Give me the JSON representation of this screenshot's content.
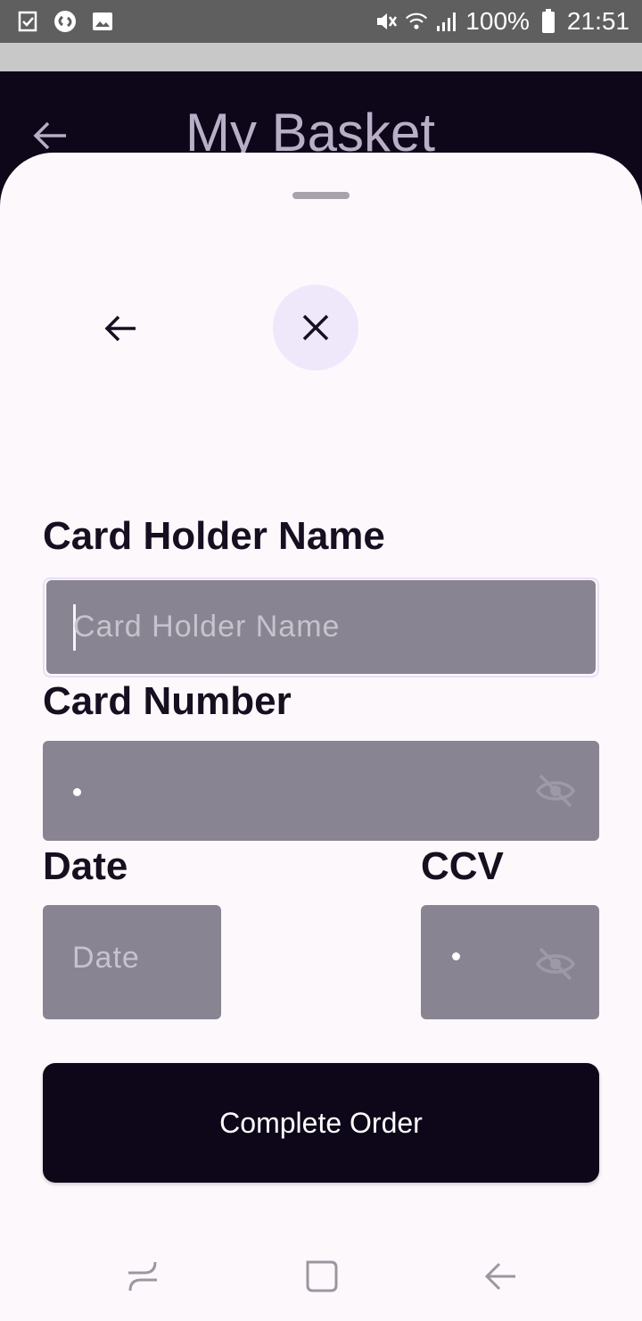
{
  "status_bar": {
    "battery": "100%",
    "time": "21:51",
    "icons": [
      "task-icon",
      "shazam-icon",
      "gallery-icon",
      "mute-icon",
      "wifi-icon",
      "signal-icon",
      "battery-icon"
    ]
  },
  "header": {
    "title": "My Basket",
    "back_icon": "arrow-left-icon"
  },
  "sheet": {
    "back_icon": "arrow-left-icon",
    "close_icon": "close-icon",
    "card_holder": {
      "label": "Card Holder Name",
      "placeholder": "Card Holder Name",
      "value": ""
    },
    "card_number": {
      "label": "Card Number",
      "masked_value": "•",
      "toggle_icon": "eye-off-icon"
    },
    "date": {
      "label": "Date",
      "placeholder": "Date"
    },
    "ccv": {
      "label": "CCV",
      "masked_value": "•",
      "toggle_icon": "eye-off-icon"
    },
    "submit_label": "Complete Order"
  },
  "nav_bar": {
    "items": [
      "recents-icon",
      "home-icon",
      "back-icon"
    ]
  },
  "colors": {
    "header_bg": "#0d0719",
    "sheet_bg": "#fdf8fc",
    "input_bg": "#898491",
    "close_button_bg": "#efe7fa",
    "button_bg": "#0d0719"
  }
}
